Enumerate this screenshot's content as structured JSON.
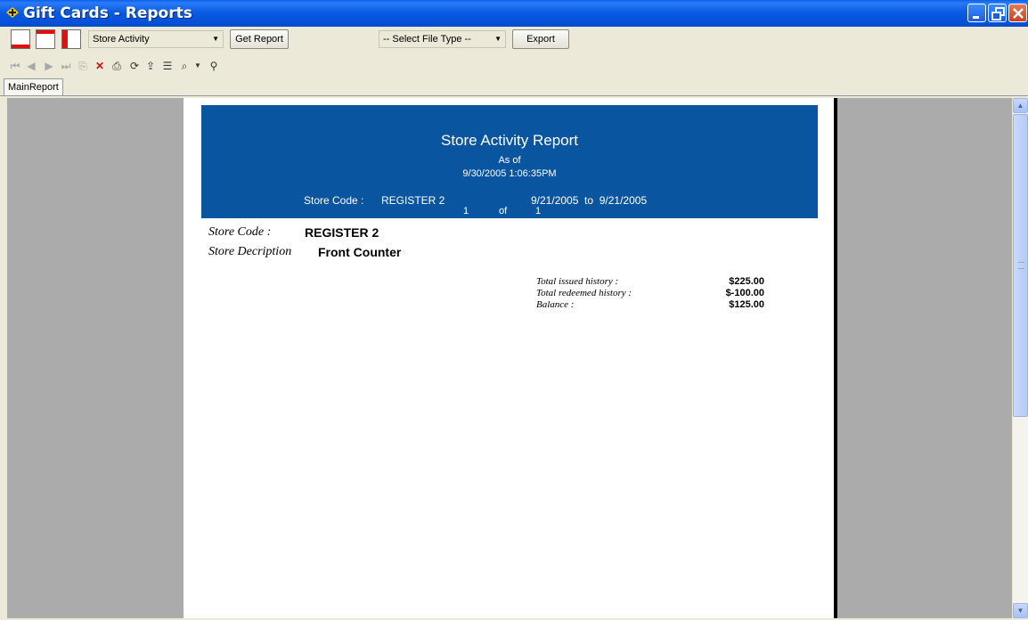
{
  "window": {
    "title": "Gift Cards - Reports"
  },
  "toolbar": {
    "report_select": "Store Activity",
    "get_report_label": "Get Report",
    "file_type_select": "-- Select File Type --",
    "export_label": "Export"
  },
  "icons": [
    "first-page-icon",
    "prev-page-icon",
    "next-page-icon",
    "last-page-icon",
    "goto-page-icon",
    "close-icon",
    "print-icon",
    "refresh-icon",
    "export-icon",
    "group-tree-icon",
    "zoom-icon",
    "dropdown-icon",
    "search-icon"
  ],
  "tabs": [
    {
      "label": "MainReport"
    }
  ],
  "report": {
    "title": "Store Activity Report",
    "as_of_label": "As of",
    "as_of_datetime": "9/30/2005  1:06:35PM",
    "store_code_header_label": "Store Code :",
    "store_code_header_value": "REGISTER 2",
    "date_range": "9/21/2005  to  9/21/2005",
    "page_current": "1",
    "page_of": "of",
    "page_total": "1",
    "store_code_label": "Store Code :",
    "store_code_value": "REGISTER 2",
    "store_desc_label": "Store Decription",
    "store_desc_value": "Front Counter",
    "summary": [
      {
        "label": "Total issued history :",
        "value": "$225.00"
      },
      {
        "label": "Total redeemed history :",
        "value": "$-100.00"
      },
      {
        "label": "Balance :",
        "value": "$125.00"
      }
    ]
  },
  "colors": {
    "titlebar": "#0858e0",
    "report_header": "#0a55a0",
    "viewer_bg": "#ababab",
    "accent_red": "#e01010"
  }
}
